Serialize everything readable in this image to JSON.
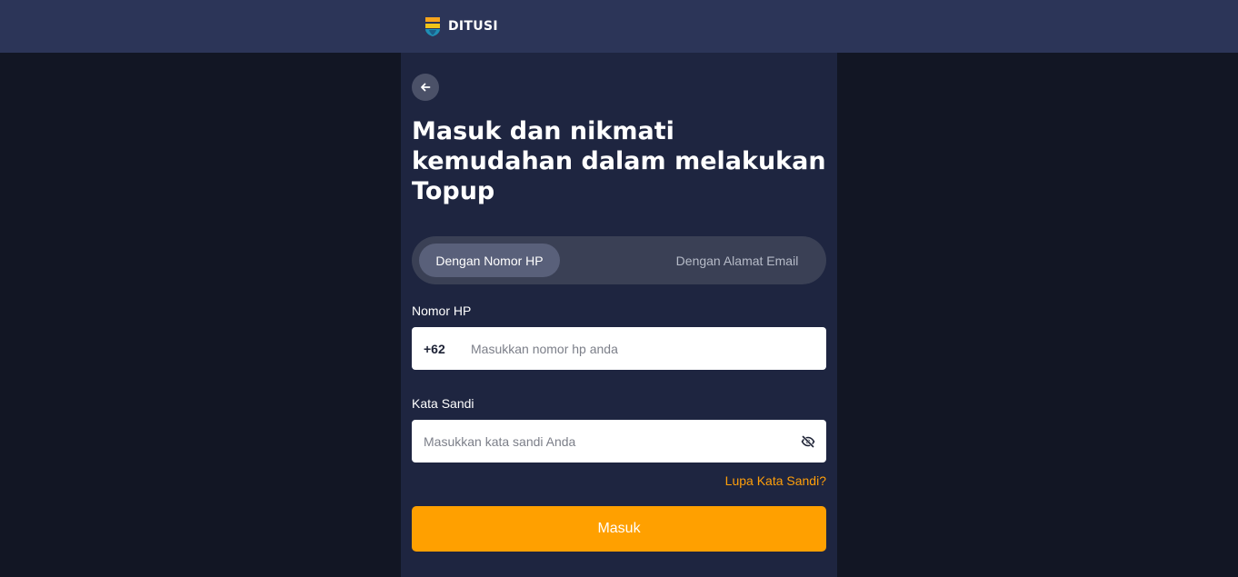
{
  "header": {
    "brand": "DITUSI",
    "logo_icon": "ditusi-shield-logo"
  },
  "form": {
    "headline": "Masuk dan nikmati kemudahan dalam melakukan Topup",
    "tabs": [
      {
        "label": "Dengan Nomor HP",
        "active": true
      },
      {
        "label": "Dengan Alamat Email",
        "active": false
      }
    ],
    "phone": {
      "label": "Nomor HP",
      "prefix": "+62",
      "placeholder": "Masukkan nomor hp anda",
      "value": ""
    },
    "password": {
      "label": "Kata Sandi",
      "placeholder": "Masukkan kata sandi Anda",
      "value": "",
      "toggle_icon": "eye-off-icon"
    },
    "forgot_label": "Lupa Kata Sandi?",
    "submit_label": "Masuk"
  },
  "colors": {
    "topbar": "#2c3558",
    "page_bg": "#121624",
    "panel_bg": "#1e2540",
    "accent": "#ffa000",
    "link": "#ff9f0a"
  }
}
